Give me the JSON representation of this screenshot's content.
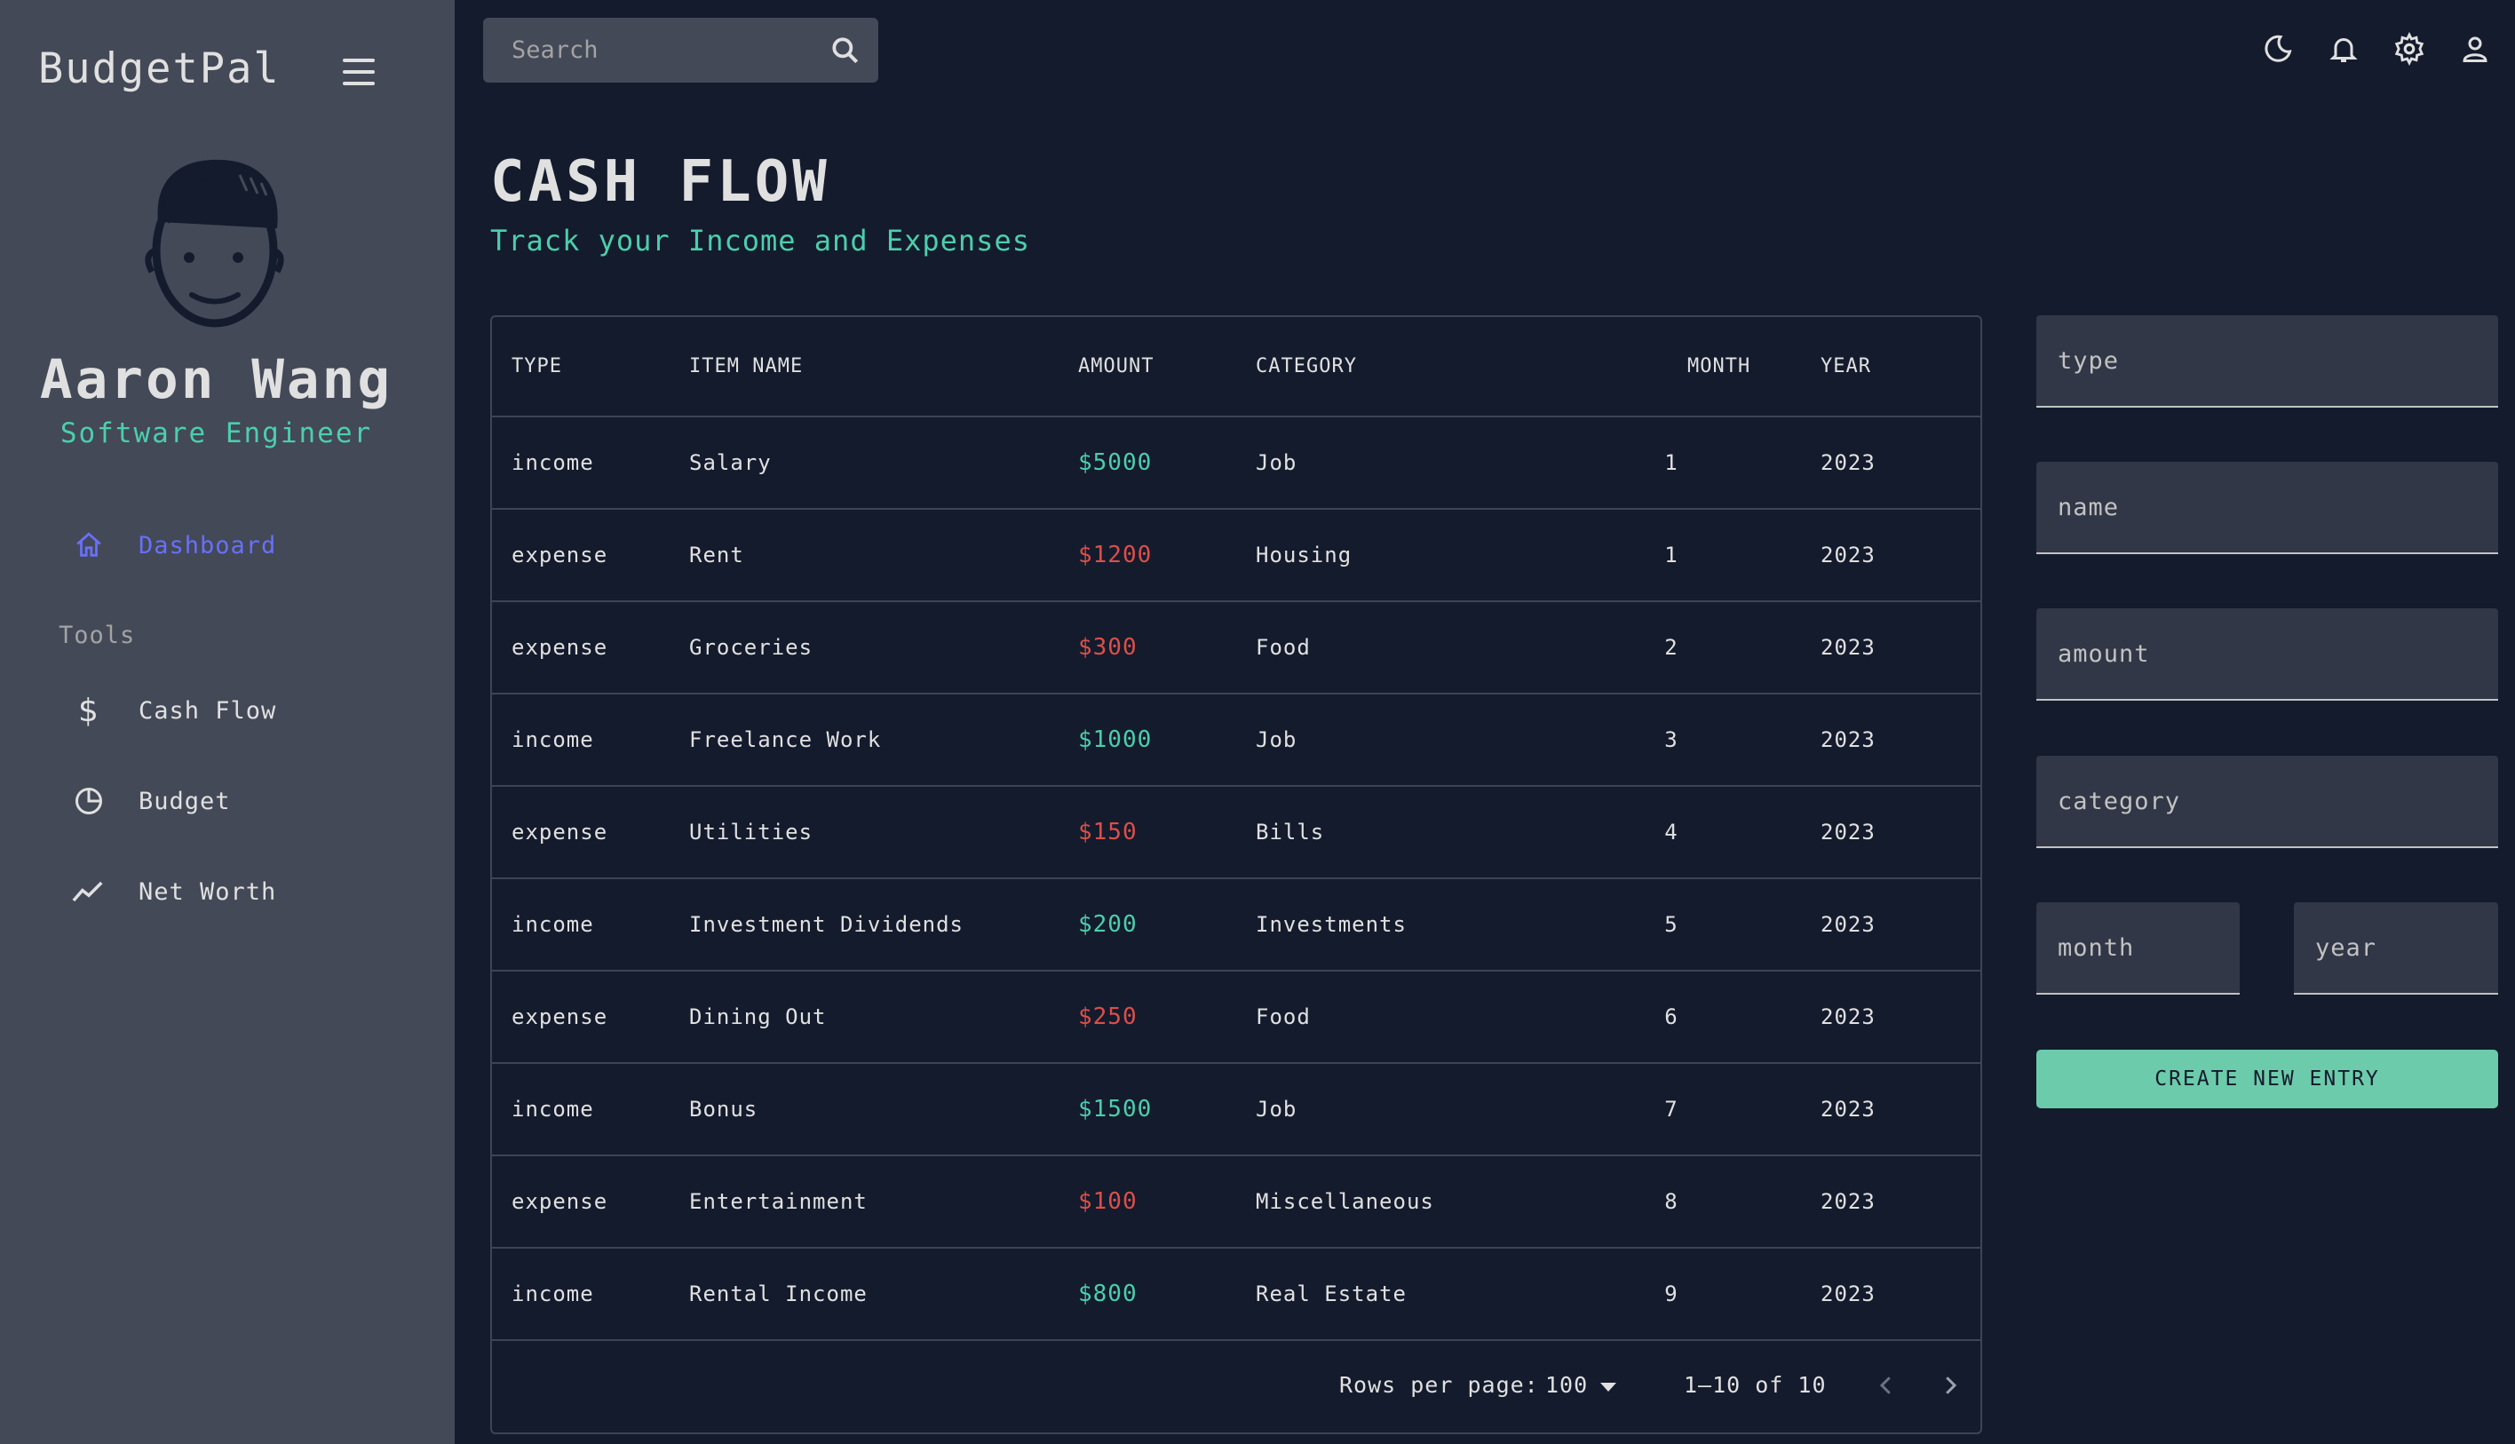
{
  "app": {
    "brand": "BudgetPal"
  },
  "profile": {
    "name": "Aaron Wang",
    "role": "Software Engineer"
  },
  "nav": {
    "dashboard": "Dashboard",
    "tools_label": "Tools",
    "cash_flow": "Cash Flow",
    "budget": "Budget",
    "net_worth": "Net Worth"
  },
  "search": {
    "placeholder": "Search"
  },
  "page": {
    "title": "CASH FLOW",
    "subtitle": "Track your Income and Expenses"
  },
  "table": {
    "headers": {
      "type": "TYPE",
      "name": "ITEM NAME",
      "amount": "AMOUNT",
      "category": "CATEGORY",
      "month": "MONTH",
      "year": "YEAR"
    },
    "rows": [
      {
        "type": "income",
        "name": "Salary",
        "amount": "$5000",
        "category": "Job",
        "month": "1",
        "year": "2023"
      },
      {
        "type": "expense",
        "name": "Rent",
        "amount": "$1200",
        "category": "Housing",
        "month": "1",
        "year": "2023"
      },
      {
        "type": "expense",
        "name": "Groceries",
        "amount": "$300",
        "category": "Food",
        "month": "2",
        "year": "2023"
      },
      {
        "type": "income",
        "name": "Freelance Work",
        "amount": "$1000",
        "category": "Job",
        "month": "3",
        "year": "2023"
      },
      {
        "type": "expense",
        "name": "Utilities",
        "amount": "$150",
        "category": "Bills",
        "month": "4",
        "year": "2023"
      },
      {
        "type": "income",
        "name": "Investment Dividends",
        "amount": "$200",
        "category": "Investments",
        "month": "5",
        "year": "2023"
      },
      {
        "type": "expense",
        "name": "Dining Out",
        "amount": "$250",
        "category": "Food",
        "month": "6",
        "year": "2023"
      },
      {
        "type": "income",
        "name": "Bonus",
        "amount": "$1500",
        "category": "Job",
        "month": "7",
        "year": "2023"
      },
      {
        "type": "expense",
        "name": "Entertainment",
        "amount": "$100",
        "category": "Miscellaneous",
        "month": "8",
        "year": "2023"
      },
      {
        "type": "income",
        "name": "Rental Income",
        "amount": "$800",
        "category": "Real Estate",
        "month": "9",
        "year": "2023"
      }
    ],
    "pagination": {
      "rows_per_page_label": "Rows per page:",
      "rows_per_page": "100",
      "range": "1–10 of 10"
    }
  },
  "form": {
    "type_placeholder": "type",
    "name_placeholder": "name",
    "amount_placeholder": "amount",
    "category_placeholder": "category",
    "month_placeholder": "month",
    "year_placeholder": "year",
    "submit_label": "CREATE NEW ENTRY"
  },
  "colors": {
    "income": "#4cceac",
    "expense": "#db4f4a",
    "accent": "#6870fa",
    "button": "#6ccbaa"
  },
  "icons": [
    "menu-icon",
    "home-icon",
    "dollar-icon",
    "pie-chart-icon",
    "trend-line-icon",
    "search-icon",
    "dark-mode-icon",
    "bell-icon",
    "gear-icon",
    "user-icon",
    "chevron-left-icon",
    "chevron-right-icon"
  ]
}
